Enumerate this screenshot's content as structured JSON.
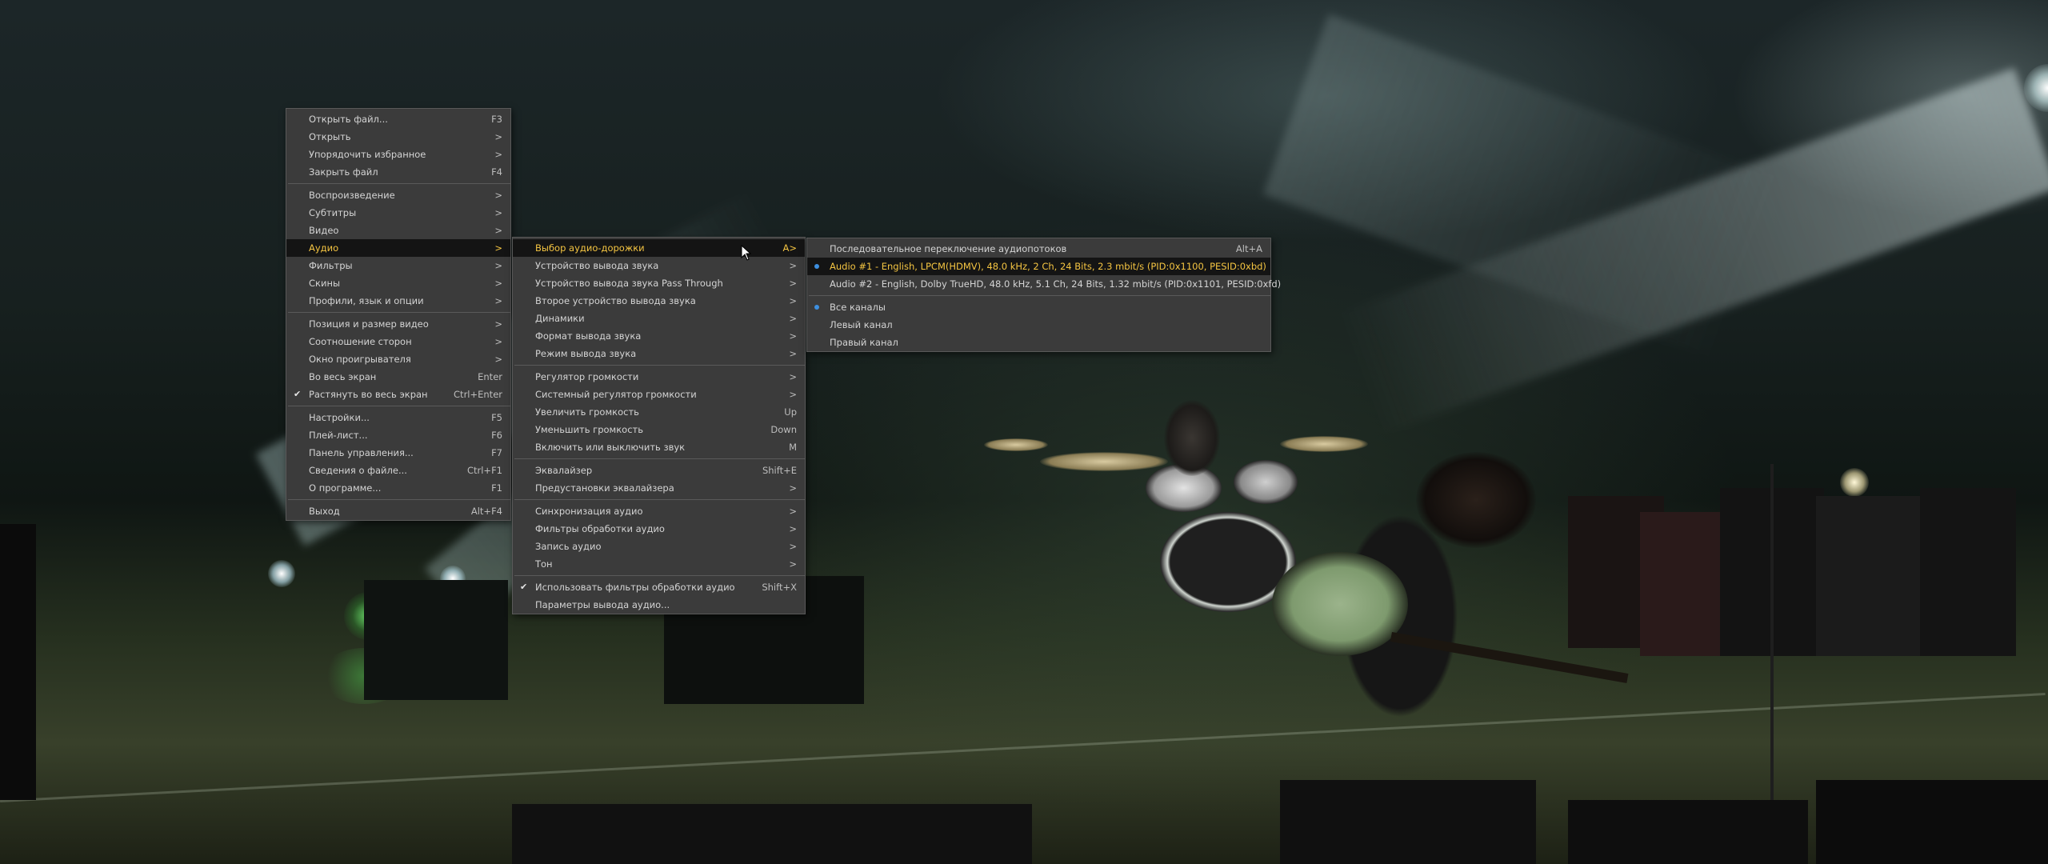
{
  "colors": {
    "menu_bg": "#3b3b3b",
    "menu_text": "#d4d4d4",
    "highlight_bg": "#141414",
    "highlight_text": "#f5c542",
    "radio_dot": "#3d8fe0"
  },
  "main_menu": {
    "items": [
      {
        "label": "Открыть файл...",
        "shortcut": "F3"
      },
      {
        "label": "Открыть",
        "shortcut": ">"
      },
      {
        "label": "Упорядочить избранное",
        "shortcut": ">"
      },
      {
        "label": "Закрыть файл",
        "shortcut": "F4"
      },
      {
        "label": "Воспроизведение",
        "shortcut": ">"
      },
      {
        "label": "Субтитры",
        "shortcut": ">"
      },
      {
        "label": "Видео",
        "shortcut": ">"
      },
      {
        "label": "Аудио",
        "shortcut": ">"
      },
      {
        "label": "Фильтры",
        "shortcut": ">"
      },
      {
        "label": "Скины",
        "shortcut": ">"
      },
      {
        "label": "Профили, язык и опции",
        "shortcut": ">"
      },
      {
        "label": "Позиция и размер видео",
        "shortcut": ">"
      },
      {
        "label": "Соотношение сторон",
        "shortcut": ">"
      },
      {
        "label": "Окно проигрывателя",
        "shortcut": ">"
      },
      {
        "label": "Во весь экран",
        "shortcut": "Enter"
      },
      {
        "label": "Растянуть во весь экран",
        "shortcut": "Ctrl+Enter"
      },
      {
        "label": "Настройки...",
        "shortcut": "F5"
      },
      {
        "label": "Плей-лист...",
        "shortcut": "F6"
      },
      {
        "label": "Панель управления...",
        "shortcut": "F7"
      },
      {
        "label": "Сведения о файле...",
        "shortcut": "Ctrl+F1"
      },
      {
        "label": "О программе...",
        "shortcut": "F1"
      },
      {
        "label": "Выход",
        "shortcut": "Alt+F4"
      }
    ]
  },
  "audio_menu": {
    "items": [
      {
        "label": "Выбор аудио-дорожки",
        "shortcut": "A>"
      },
      {
        "label": "Устройство вывода звука",
        "shortcut": ">"
      },
      {
        "label": "Устройство вывода звука Pass Through",
        "shortcut": ">"
      },
      {
        "label": "Второе устройство вывода звука",
        "shortcut": ">"
      },
      {
        "label": "Динамики",
        "shortcut": ">"
      },
      {
        "label": "Формат вывода звука",
        "shortcut": ">"
      },
      {
        "label": "Режим вывода звука",
        "shortcut": ">"
      },
      {
        "label": "Регулятор громкости",
        "shortcut": ">"
      },
      {
        "label": "Системный регулятор громкости",
        "shortcut": ">"
      },
      {
        "label": "Увеличить громкость",
        "shortcut": "Up"
      },
      {
        "label": "Уменьшить громкость",
        "shortcut": "Down"
      },
      {
        "label": "Включить или выключить звук",
        "shortcut": "M"
      },
      {
        "label": "Эквалайзер",
        "shortcut": "Shift+E"
      },
      {
        "label": "Предустановки эквалайзера",
        "shortcut": ">"
      },
      {
        "label": "Синхронизация аудио",
        "shortcut": ">"
      },
      {
        "label": "Фильтры обработки аудио",
        "shortcut": ">"
      },
      {
        "label": "Запись аудио",
        "shortcut": ">"
      },
      {
        "label": "Тон",
        "shortcut": ">"
      },
      {
        "label": "Использовать фильтры обработки аудио",
        "shortcut": "Shift+X"
      },
      {
        "label": "Параметры вывода аудио...",
        "shortcut": ""
      }
    ]
  },
  "track_menu": {
    "items": [
      {
        "label": "Последовательное переключение аудиопотоков",
        "shortcut": "Alt+A"
      },
      {
        "label": "Audio #1 - English, LPCM(HDMV), 48.0 kHz, 2 Ch, 24 Bits, 2.3 mbit/s (PID:0x1100, PESID:0xbd)",
        "shortcut": ""
      },
      {
        "label": "Audio #2 - English, Dolby TrueHD, 48.0 kHz, 5.1 Ch, 24 Bits, 1.32 mbit/s (PID:0x1101, PESID:0xfd)",
        "shortcut": ""
      },
      {
        "label": "Все каналы",
        "shortcut": ""
      },
      {
        "label": "Левый канал",
        "shortcut": ""
      },
      {
        "label": "Правый канал",
        "shortcut": ""
      }
    ]
  }
}
